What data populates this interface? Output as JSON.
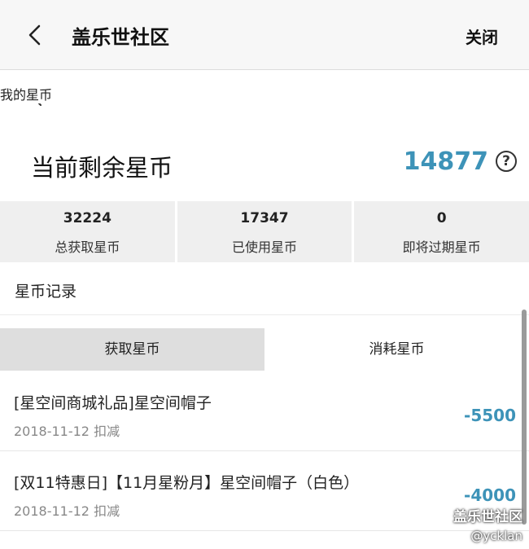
{
  "appbar": {
    "title": "盖乐世社区",
    "close_label": "关闭"
  },
  "page": {
    "title": "我的星币"
  },
  "balance": {
    "label": "当前剩余星币",
    "value": "14877",
    "help": "?"
  },
  "stats": [
    {
      "value": "32224",
      "label": "总获取星币"
    },
    {
      "value": "17347",
      "label": "已使用星币"
    },
    {
      "value": "0",
      "label": "即将过期星币"
    }
  ],
  "records_section": {
    "title": "星币记录"
  },
  "tabs": [
    {
      "label": "获取星币",
      "active": true
    },
    {
      "label": "消耗星币",
      "active": false
    }
  ],
  "records": [
    {
      "title": "[星空间商城礼品]星空间帽子",
      "date": "2018-11-12 扣减",
      "amount": "-5500"
    },
    {
      "title": "[双11特惠日]【11月星粉月】星空间帽子（白色）",
      "date": "2018-11-12 扣减",
      "amount": "-4000"
    }
  ],
  "watermark": {
    "line1": "盖乐世社区",
    "line2": "@ycklan"
  },
  "colors": {
    "accent": "#3d93b8",
    "active_tab": "#dedede",
    "stat_bg": "#efefef"
  }
}
